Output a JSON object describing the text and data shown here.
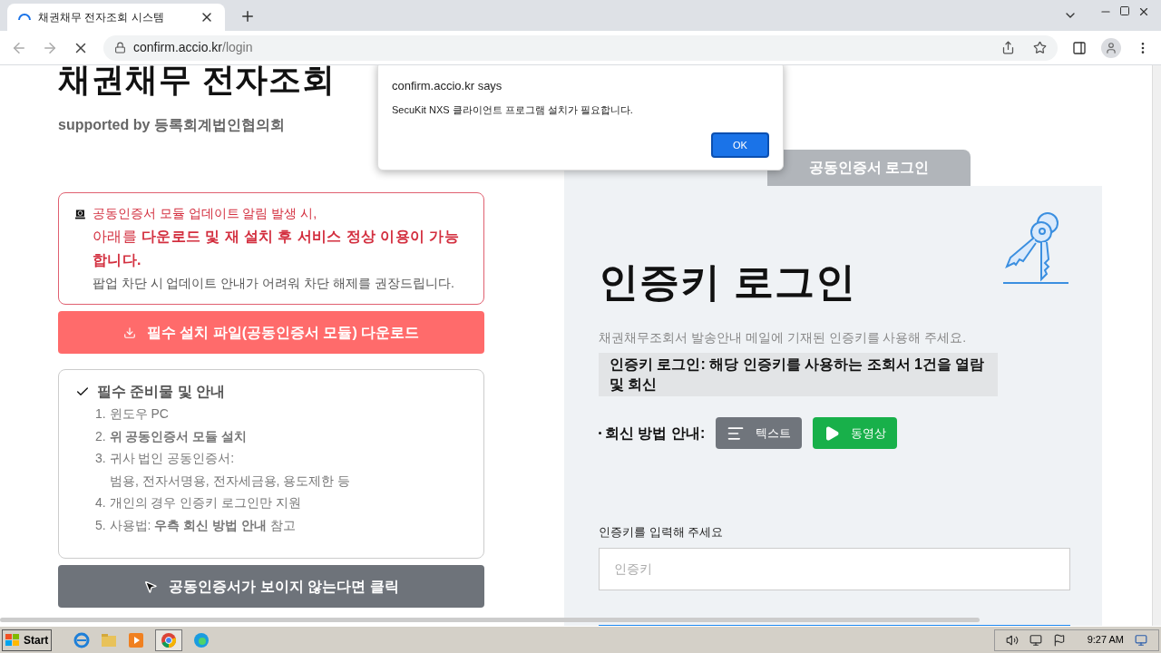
{
  "browser": {
    "tab_title": "채권채무 전자조회 시스템",
    "url_host": "confirm.accio.kr",
    "url_path": "/login"
  },
  "page": {
    "title": "채권채무 전자조회",
    "supported": "supported by 등록회계법인협의회",
    "notice": [
      "공동인증서 모듈 업데이트 알림 발생 시,",
      "아래를 **다운로드 및 재 설치 후 서비스 정상 이용이 가능합니다.**",
      "팝업 차단 시 업데이트 안내가 어려워 차단 해제를 권장드립니다."
    ],
    "download_button": "필수 설치 파일(공동인증서 모듈) 다운로드",
    "guide": {
      "title": "필수 준비물 및 안내",
      "items": [
        {
          "kind": "item",
          "text": "1. 윈도우 PC"
        },
        {
          "kind": "highlight",
          "text": "2. **위 공동인증서 모듈 설치**"
        },
        {
          "kind": "item",
          "text": "3. 귀사 법인 공동인증서:"
        },
        {
          "kind": "sub",
          "text": "범용, 전자서명용, 전자세금용, 용도제한 등"
        },
        {
          "kind": "item",
          "text": "4. 개인의 경우 인증키 로그인만 지원"
        },
        {
          "kind": "item",
          "text": "5. 사용법: **우측 회신 방법 안내** 참고"
        }
      ]
    },
    "cert_button": "공동인증서가 보이지 않는다면 클릭",
    "login_tabs": [
      {
        "selected": true
      },
      {
        "label": "공동인증서 로그인",
        "selected": false
      }
    ],
    "login": {
      "heading": "인증키 로그인",
      "description": "채권채무조회서 발송안내 메일에 기재된 인증키를 사용해 주세요.",
      "note": "인증키 로그인: 해당 인증키를 사용하는 조회서 1건을 열람 및 회신",
      "reply_label": "회신 방법 안내:",
      "reply_buttons": [
        {
          "kind": "text",
          "label": "텍스트"
        },
        {
          "kind": "video",
          "label": "동영상"
        }
      ],
      "input_label": "인증키를 입력해 주세요",
      "input_placeholder": "인증키"
    }
  },
  "dialog": {
    "title": "confirm.accio.kr says",
    "message": "SecuKit NXS 클라이언트 프로그램 설치가 필요합니다.",
    "ok": "OK"
  },
  "taskbar": {
    "start": "Start",
    "time": "9:27 AM"
  }
}
